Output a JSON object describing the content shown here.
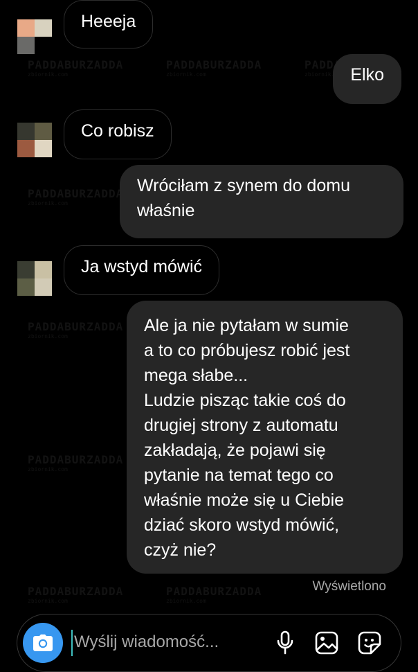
{
  "watermark": {
    "text": "PADDABURZADDA",
    "sub": "zbiornik.com"
  },
  "messages": [
    {
      "from": "them",
      "text": "Heeeja"
    },
    {
      "from": "me",
      "text": "Elko"
    },
    {
      "from": "them",
      "text": "Co robisz"
    },
    {
      "from": "me",
      "text": "Wróciłam z synem do domu\nwłaśnie"
    },
    {
      "from": "them",
      "text": "Ja wstyd mówić"
    },
    {
      "from": "me",
      "text": "Ale ja nie pytałam w sumie\na to co próbujesz robić jest\nmega słabe...\nLudzie pisząc takie coś do\ndrugiej strony z automatu\nzakładają, że pojawi się\npytanie na temat tego co\nwłaśnie może się u Ciebie\ndziać skoro wstyd mówić,\nczyż nie?"
    }
  ],
  "status": {
    "seen": "Wyświetlono"
  },
  "composer": {
    "placeholder": "Wyślij wiadomość...",
    "value": ""
  },
  "icons": {
    "camera": "camera-icon",
    "microphone": "microphone-icon",
    "gallery": "gallery-icon",
    "sticker": "sticker-icon"
  },
  "colors": {
    "background": "#000000",
    "outgoing_bubble": "#262626",
    "incoming_border": "#2d2d2d",
    "accent": "#3797f0",
    "secondary_text": "#a8a8a8"
  }
}
